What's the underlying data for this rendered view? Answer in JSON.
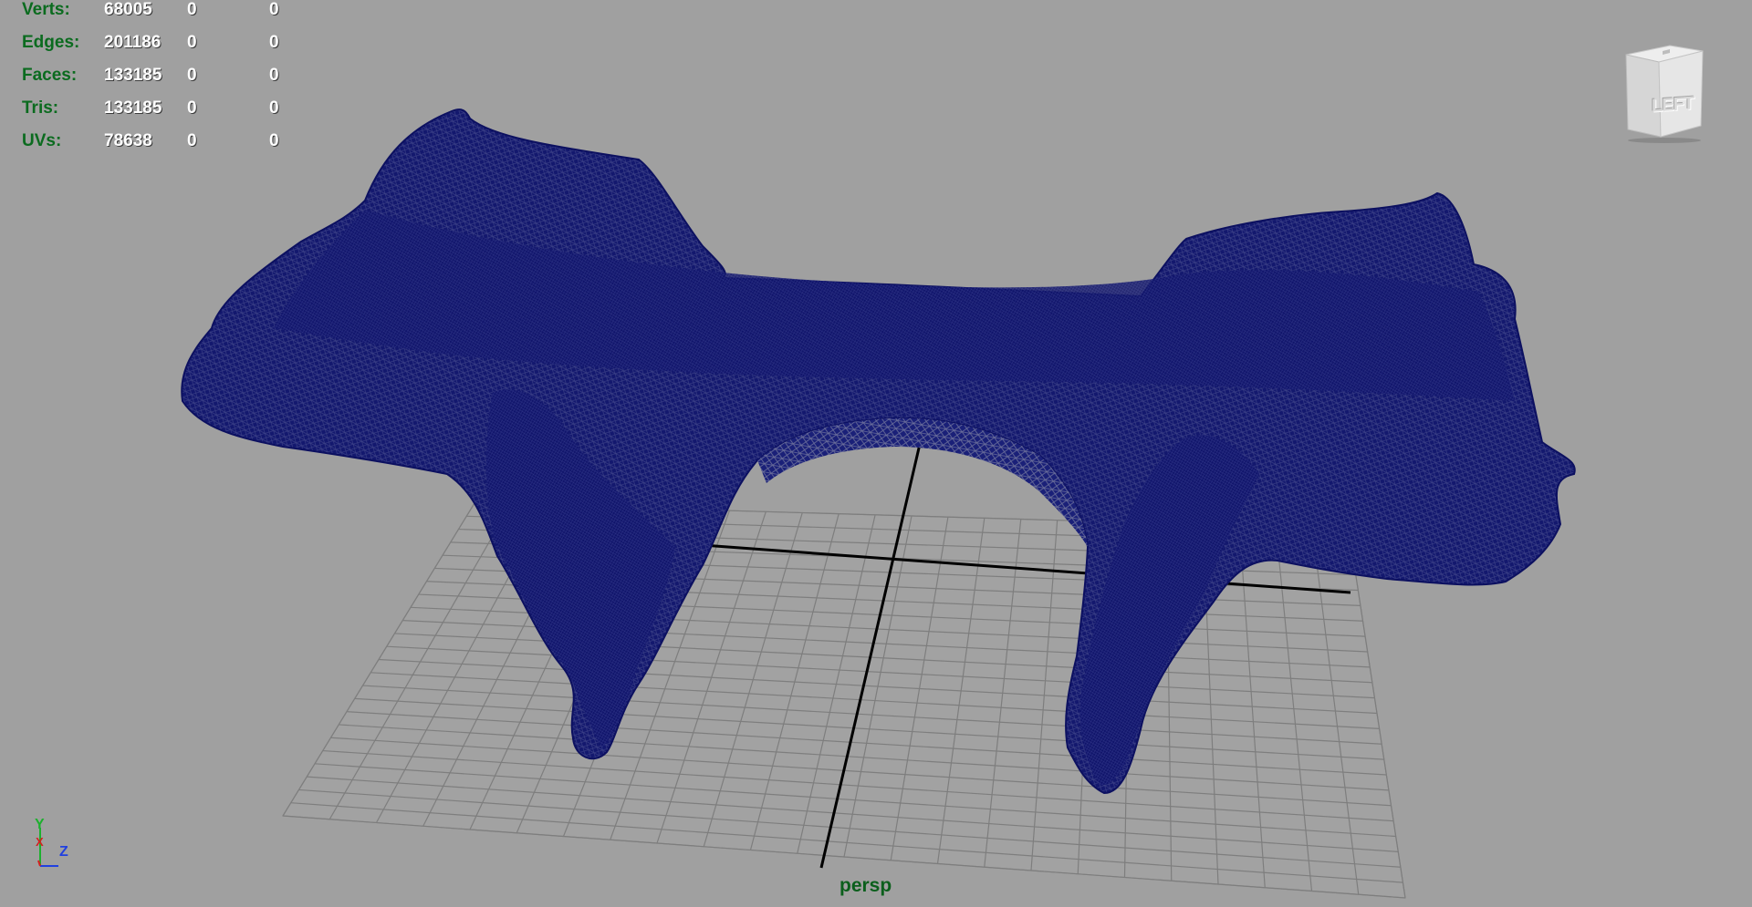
{
  "viewport": {
    "background": "#a0a0a0",
    "camera_label": "persp",
    "view_cube": {
      "face_label": "LEFT"
    },
    "axis_gizmo": {
      "y": "Y",
      "x": "X",
      "z": "Z"
    }
  },
  "heads_up_display": {
    "label_color": "#0b6b1f",
    "rows": [
      {
        "label": "Verts:",
        "total": "68005",
        "selected": "0",
        "component": "0"
      },
      {
        "label": "Edges:",
        "total": "201186",
        "selected": "0",
        "component": "0"
      },
      {
        "label": "Faces:",
        "total": "133185",
        "selected": "0",
        "component": "0"
      },
      {
        "label": "Tris:",
        "total": "133185",
        "selected": "0",
        "component": "0"
      },
      {
        "label": "UVs:",
        "total": "78638",
        "selected": "0",
        "component": "0"
      }
    ]
  },
  "mesh": {
    "display": "wireframe",
    "wire_color": "#0f1a7a"
  },
  "grid": {
    "line_color": "#7e7e7e",
    "axis_color": "#000000"
  }
}
